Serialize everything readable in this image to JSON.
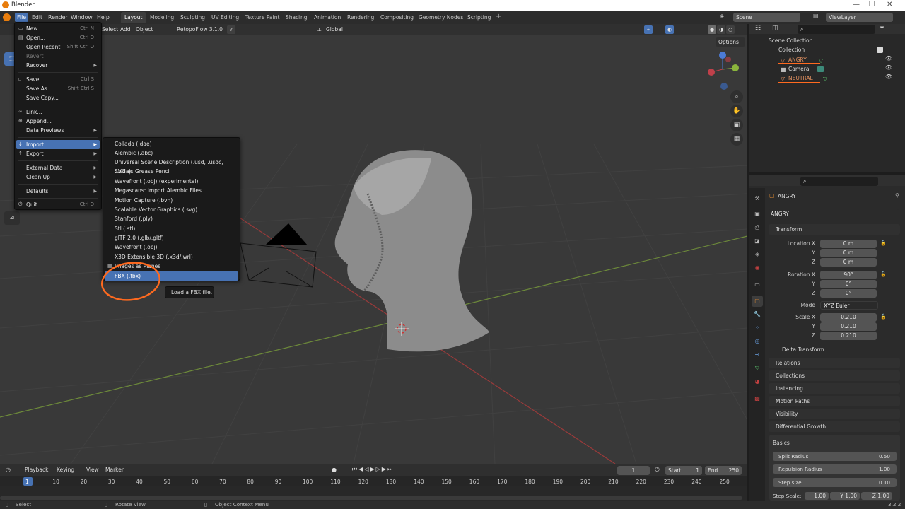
{
  "app": {
    "title": "Blender",
    "version": "3.2.2"
  },
  "menubar": [
    "File",
    "Edit",
    "Render",
    "Window",
    "Help"
  ],
  "workspaces": [
    "Layout",
    "Modeling",
    "Sculpting",
    "UV Editing",
    "Texture Paint",
    "Shading",
    "Animation",
    "Rendering",
    "Compositing",
    "Geometry Nodes",
    "Scripting"
  ],
  "scene": "Scene",
  "view_layer": "ViewLayer",
  "viewport_header": {
    "select": "Select",
    "add": "Add",
    "object": "Object",
    "addon": "RetopoFlow 3.1.0",
    "orientation": "Global",
    "options": "Options"
  },
  "file_menu": [
    {
      "label": "New",
      "shortcut": "Ctrl N"
    },
    {
      "label": "Open...",
      "shortcut": "Ctrl O"
    },
    {
      "label": "Open Recent",
      "shortcut": "Shift Ctrl O"
    },
    {
      "label": "Revert",
      "shortcut": ""
    },
    {
      "label": "Recover",
      "shortcut": ""
    },
    {
      "label": "Save",
      "shortcut": "Ctrl S"
    },
    {
      "label": "Save As...",
      "shortcut": "Shift Ctrl S"
    },
    {
      "label": "Save Copy...",
      "shortcut": ""
    },
    {
      "label": "Link...",
      "shortcut": ""
    },
    {
      "label": "Append...",
      "shortcut": ""
    },
    {
      "label": "Data Previews",
      "shortcut": ""
    },
    {
      "label": "Import",
      "shortcut": ""
    },
    {
      "label": "Export",
      "shortcut": ""
    },
    {
      "label": "External Data",
      "shortcut": ""
    },
    {
      "label": "Clean Up",
      "shortcut": ""
    },
    {
      "label": "Defaults",
      "shortcut": ""
    },
    {
      "label": "Quit",
      "shortcut": "Ctrl Q"
    }
  ],
  "import_menu": [
    "Collada (.dae)",
    "Alembic (.abc)",
    "Universal Scene Description (.usd, .usdc, .usda)",
    "SVG as Grease Pencil",
    "Wavefront (.obj) (experimental)",
    "Megascans: Import Alembic Files",
    "Motion Capture (.bvh)",
    "Scalable Vector Graphics (.svg)",
    "Stanford (.ply)",
    "Stl (.stl)",
    "glTF 2.0 (.glb/.gltf)",
    "Wavefront (.obj)",
    "X3D Extensible 3D (.x3d/.wrl)",
    "Images as Planes",
    "FBX (.fbx)"
  ],
  "tooltip": "Load a FBX file.",
  "outliner": {
    "root": "Scene Collection",
    "collection": "Collection",
    "items": [
      "ANGRY",
      "Camera",
      "NEUTRAL"
    ]
  },
  "properties": {
    "object_name": "ANGRY",
    "data_name": "ANGRY",
    "transform": {
      "title": "Transform",
      "location_label": "Location X",
      "location": [
        "0 m",
        "0 m",
        "0 m"
      ],
      "rotation_label": "Rotation X",
      "rotation": [
        "90°",
        "0°",
        "0°"
      ],
      "mode_label": "Mode",
      "mode": "XYZ Euler",
      "scale_label": "Scale X",
      "scale": [
        "0.210",
        "0.210",
        "0.210"
      ],
      "axis_y": "Y",
      "axis_z": "Z"
    },
    "panels": [
      "Delta Transform",
      "Relations",
      "Collections",
      "Instancing",
      "Motion Paths",
      "Visibility"
    ],
    "modifier_panel": "Differential Growth",
    "basics": "Basics",
    "sliders": [
      {
        "label": "Split Radius",
        "value": "0.50"
      },
      {
        "label": "Repulsion Radius",
        "value": "1.00"
      },
      {
        "label": "Step size",
        "value": "0.10"
      }
    ],
    "step_scale": {
      "label": "Step Scale:",
      "x": "1.00",
      "y": "Y 1.00",
      "z": "Z 1.00"
    }
  },
  "timeline": {
    "menus": [
      "Playback",
      "Keying",
      "View",
      "Marker"
    ],
    "frame": "1",
    "start_label": "Start",
    "start": "1",
    "end_label": "End",
    "end": "250",
    "ticks": [
      "1",
      "10",
      "20",
      "30",
      "40",
      "50",
      "60",
      "70",
      "80",
      "90",
      "100",
      "110",
      "120",
      "130",
      "140",
      "150",
      "160",
      "170",
      "180",
      "190",
      "200",
      "210",
      "220",
      "230",
      "240",
      "250"
    ]
  },
  "statusbar": {
    "left": "Select",
    "mid": "Rotate View",
    "right": "Object Context Menu",
    "version": "3.2.2"
  },
  "colors": {
    "accent": "#4772b3",
    "annotation": "#ff6a1f",
    "background": "#393939"
  }
}
